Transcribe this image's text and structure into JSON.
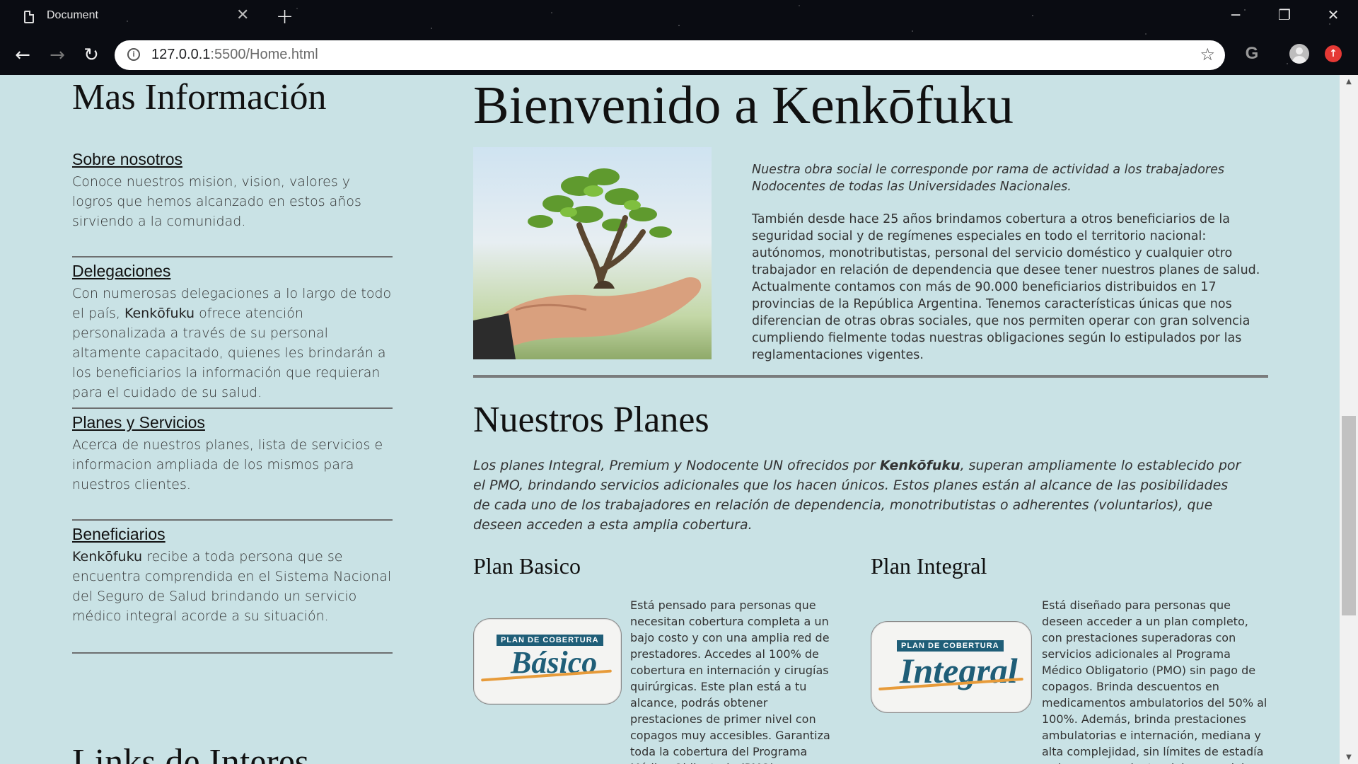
{
  "browser": {
    "tab_title": "Document",
    "tab_close": "✕",
    "new_tab": "+",
    "url_host": "127.0.0.1",
    "url_rest": ":5500/Home.html",
    "back": "←",
    "forward": "→",
    "reload": "↻",
    "star": "☆",
    "g_letter": "G",
    "update": "↑",
    "minimize": "─",
    "restore": "❐",
    "close": "✕",
    "info": "i"
  },
  "sidebar": {
    "title": "Mas Información",
    "sections": [
      {
        "link": "Sobre nosotros",
        "text_before": "Conoce nuestros mision, vision, valores y logros que hemos alcanzado en estos años sirviendo a la comunidad.",
        "bold": "",
        "text_after": ""
      },
      {
        "link": "Delegaciones",
        "text_before": "Con numerosas delegaciones a lo largo de todo el país, ",
        "bold": "Kenkōfuku",
        "text_after": " ofrece atención personalizada a través de su personal altamente capacitado, quienes les brindarán a los beneficiarios la información que requieran para el cuidado de su salud."
      },
      {
        "link": "Planes y Servicios",
        "text_before": "Acerca de nuestros planes, lista de servicios e informacion ampliada de los mismos para nuestros clientes.",
        "bold": "",
        "text_after": ""
      },
      {
        "link": "Beneficiarios",
        "text_before": "",
        "bold": "Kenkōfuku",
        "text_after": " recibe a toda persona que se encuentra comprendida en el Sistema Nacional del Seguro de Salud brindando un servicio médico integral acorde a su situación."
      }
    ],
    "links_title": "Links de Interes"
  },
  "main": {
    "title": "Bienvenido a Kenkōfuku",
    "intro_lead": "Nuestra obra social le corresponde por rama de actividad a los trabajadores Nodocentes de todas las Universidades Nacionales.",
    "intro_body": "También desde hace 25 años brindamos cobertura a otros beneficiarios de la seguridad social y de regímenes especiales en todo el territorio nacional: autónomos, monotributistas, personal del servicio doméstico y cualquier otro trabajador en relación de dependencia que desee tener nuestros planes de salud. Actualmente contamos con más de 90.000 beneficiarios distribuidos en 17 provincias de la República Argentina. Tenemos características únicas que nos diferencian de otras obras sociales, que nos permiten operar con gran solvencia cumpliendo fielmente todas nuestras obligaciones según lo estipulados por las reglamentaciones vigentes.",
    "plans_title": "Nuestros Planes",
    "plans_desc_before": "Los planes Integral, Premium y Nodocente UN ofrecidos por ",
    "plans_desc_bold": "Kenkōfuku",
    "plans_desc_after": ", superan ampliamente lo establecido por el PMO, brindando servicios adicionales que los hacen únicos. Estos planes están al alcance de las posibilidades de cada uno de los trabajadores en relación de dependencia, monotributistas o adherentes (voluntarios), que deseen acceden a esta amplia cobertura.",
    "plans": [
      {
        "name": "Plan Basico",
        "logo_tag": "PLAN DE COBERTURA",
        "logo_script": "Básico",
        "text": "Está pensado para personas que necesitan cobertura completa a un bajo costo y con una amplia red de prestadores. Accedes al 100% de cobertura en internación y cirugías quirúrgicas. Este plan está a tu alcance, podrás obtener prestaciones de primer nivel con copagos muy accesibles. Garantiza toda la cobertura del Programa Médico Obligatorio (PMO)."
      },
      {
        "name": "Plan Integral",
        "logo_tag": "PLAN DE COBERTURA",
        "logo_script": "Integral",
        "text": "Está diseñado para personas que deseen acceder a un plan completo, con prestaciones superadoras con servicios adicionales al Programa Médico Obligatorio (PMO) sin pago de copagos. Brinda descuentos en medicamentos ambulatorios del 50% al 100%. Además, brinda prestaciones ambulatorias e internación, mediana y alta complejidad, sin límites de estadía y sin copagos, dentro del marco del PMO."
      }
    ]
  },
  "colors": {
    "page_bg": "#c9e2e5",
    "rule": "#7a7c7d",
    "logo_blue": "#1f5e78",
    "logo_orange": "#e79b3a"
  },
  "icons": [
    "document-icon",
    "close-icon",
    "plus-icon",
    "back-arrow-icon",
    "forward-arrow-icon",
    "reload-icon",
    "info-icon",
    "star-icon",
    "google-icon",
    "avatar-icon",
    "update-icon",
    "minimize-icon",
    "restore-icon",
    "close-window-icon"
  ]
}
